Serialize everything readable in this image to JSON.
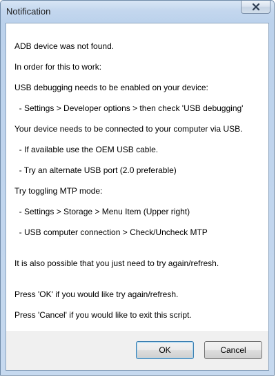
{
  "window": {
    "title": "Notification"
  },
  "message_lines": [
    "ADB device was not found.",
    "In order for this to work:",
    "USB debugging needs to be enabled on your device:",
    "  - Settings > Developer options > then check 'USB debugging'",
    "Your device needs to be connected to your computer via USB.",
    "  - If available use the OEM USB cable.",
    "  - Try an alternate USB port (2.0 preferable)",
    "Try toggling MTP mode:",
    "  - Settings > Storage > Menu Item (Upper right)",
    "  - USB computer connection > Check/Uncheck MTP",
    "It is also possible that you just need to try again/refresh.",
    "Press 'OK' if you would like try again/refresh.",
    "Press 'Cancel' if you would like to exit this script."
  ],
  "buttons": {
    "ok_label": "OK",
    "cancel_label": "Cancel"
  },
  "icons": {
    "close": "close-icon"
  }
}
